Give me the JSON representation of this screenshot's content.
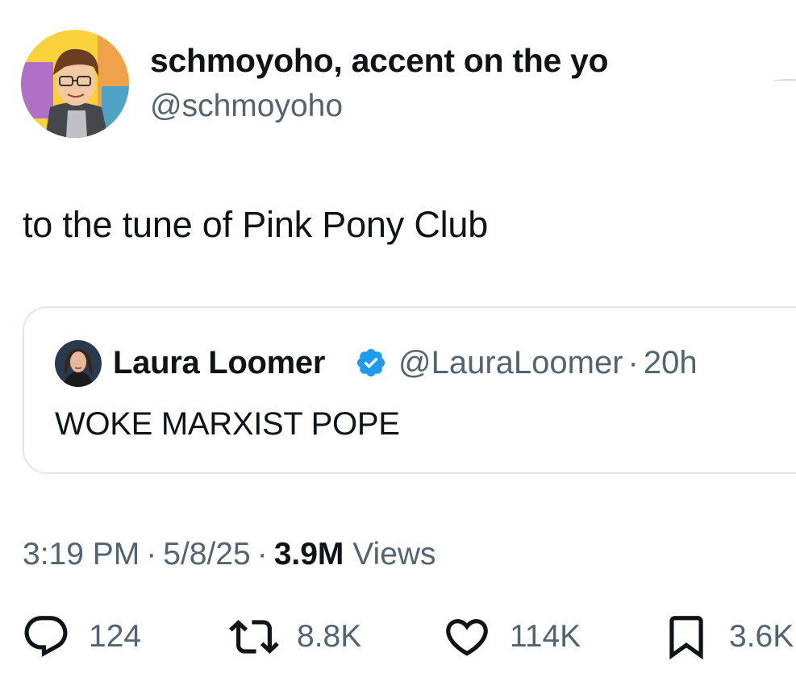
{
  "author": {
    "display_name": "schmoyoho, accent on the yo",
    "handle": "@schmoyoho",
    "avatar_icon": "cartoon-avatar"
  },
  "tweet": {
    "text": "to the tune of Pink Pony Club",
    "time": "3:19 PM",
    "date": "5/8/25",
    "views_count": "3.9M",
    "views_label": "Views",
    "separator": "·"
  },
  "quoted": {
    "display_name": "Laura Loomer",
    "handle": "@LauraLoomer",
    "age": "20h",
    "separator": "·",
    "text": "WOKE MARXIST POPE",
    "verified_icon": "verified-badge-icon",
    "badge_color": "#1d9bf0"
  },
  "actions": {
    "replies": "124",
    "retweets": "8.8K",
    "likes": "114K",
    "bookmarks": "3.6K"
  },
  "colors": {
    "text": "#0f1419",
    "secondary": "#536471",
    "border": "#e2e6e9"
  }
}
